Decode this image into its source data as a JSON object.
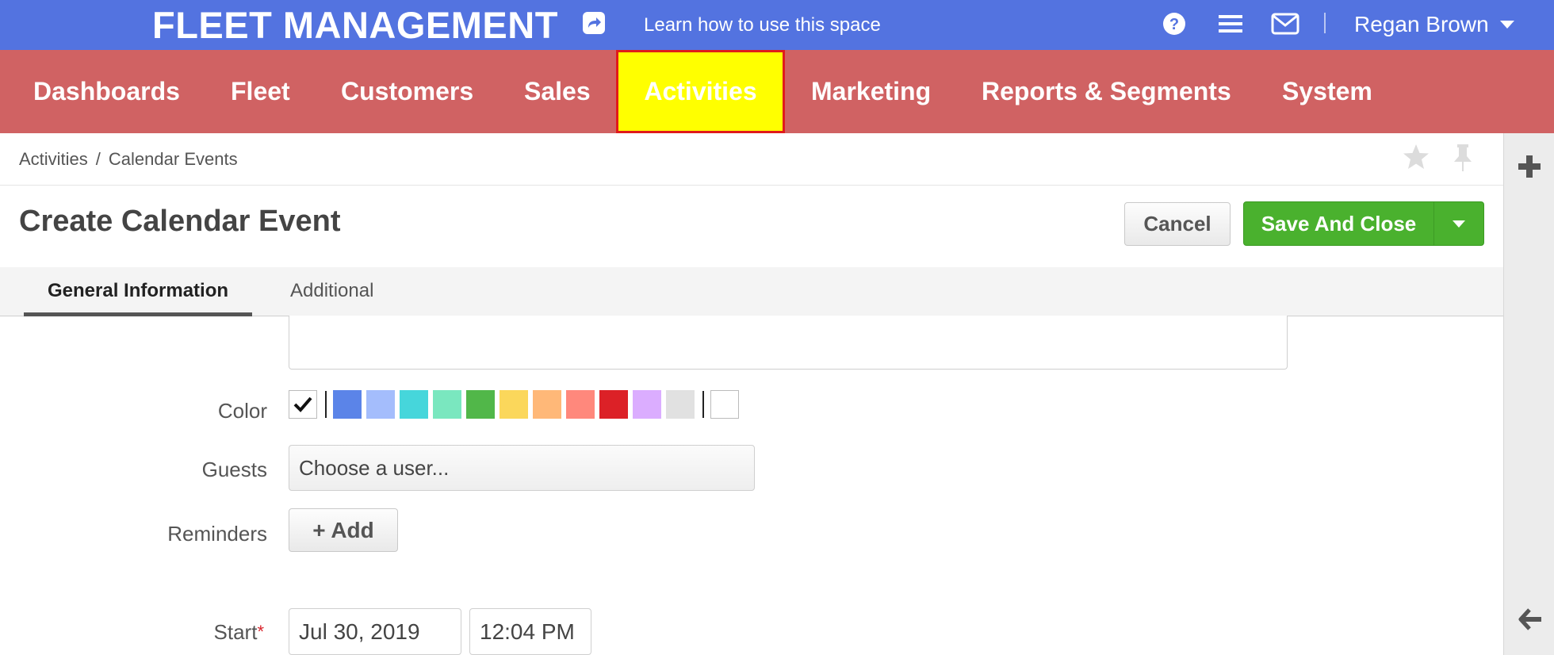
{
  "header": {
    "app_title": "FLEET MANAGEMENT",
    "learn_link": "Learn how to use this space",
    "user_name": "Regan Brown",
    "icons": [
      "share-icon",
      "help-icon",
      "menu-icon",
      "mail-icon",
      "chevron-down-icon"
    ]
  },
  "nav": {
    "items": [
      {
        "label": "Dashboards"
      },
      {
        "label": "Fleet"
      },
      {
        "label": "Customers"
      },
      {
        "label": "Sales"
      },
      {
        "label": "Activities",
        "active": true
      },
      {
        "label": "Marketing"
      },
      {
        "label": "Reports & Segments"
      },
      {
        "label": "System"
      }
    ],
    "active_bg": "#ffff00",
    "active_border": "#e01b1b"
  },
  "breadcrumb": {
    "parent": "Activities",
    "separator": "/",
    "current": "Calendar Events"
  },
  "page": {
    "title": "Create Calendar Event",
    "cancel_label": "Cancel",
    "save_label": "Save And Close"
  },
  "tabs": [
    {
      "label": "General Information",
      "active": true
    },
    {
      "label": "Additional",
      "active": false
    }
  ],
  "form": {
    "color_label": "Color",
    "colors": [
      "#5b84e8",
      "#a4bdfc",
      "#46d6db",
      "#7ae7bf",
      "#51b749",
      "#fbd75b",
      "#ffb878",
      "#ff887c",
      "#dc2127",
      "#dbadff",
      "#e1e1e1"
    ],
    "guests_label": "Guests",
    "guests_placeholder": "Choose a user...",
    "reminders_label": "Reminders",
    "add_reminder_label": "+ Add",
    "start_label": "Start",
    "required_mark": "*",
    "start_date": "Jul 30, 2019",
    "start_time": "12:04 PM"
  },
  "colors": {
    "topbar": "#5373e0",
    "navbar": "#d06263",
    "save_button": "#4ab12e"
  }
}
